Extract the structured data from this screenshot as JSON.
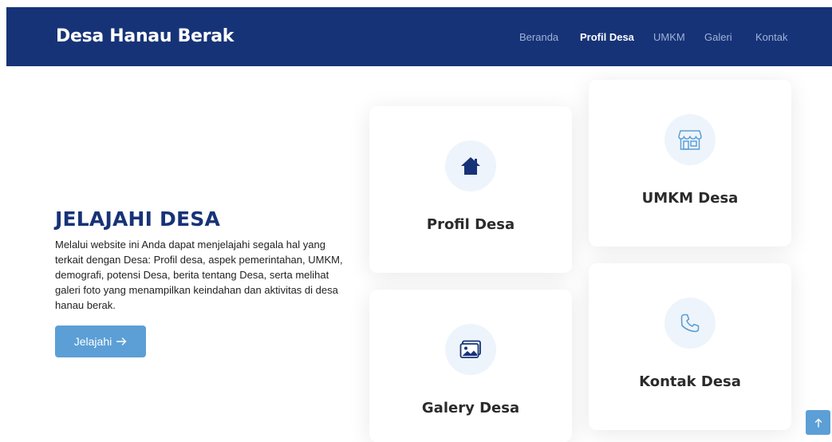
{
  "navbar": {
    "brand": "Desa Hanau Berak",
    "links": [
      {
        "label": "Beranda",
        "active": false
      },
      {
        "label": "Profil Desa",
        "active": true
      },
      {
        "label": "UMKM",
        "active": false
      },
      {
        "label": "Galeri",
        "active": false
      },
      {
        "label": "Kontak",
        "active": false
      }
    ]
  },
  "hero": {
    "title": "JELAJAHI DESA",
    "description": "Melalui website ini Anda dapat menjelajahi segala hal yang terkait dengan Desa: Profil desa, aspek pemerintahan, UMKM, demografi, potensi Desa, berita tentang Desa, serta melihat galeri foto yang menampilkan keindahan dan aktivitas di desa hanau berak.",
    "button_label": "Jelajahi",
    "button_icon": "arrow-right-icon"
  },
  "cards": [
    {
      "title": "Profil Desa",
      "icon": "house-icon"
    },
    {
      "title": "UMKM Desa",
      "icon": "store-icon"
    },
    {
      "title": "Galery Desa",
      "icon": "image-icon"
    },
    {
      "title": "Kontak Desa",
      "icon": "phone-icon"
    }
  ],
  "scroll_top": {
    "icon": "arrow-up-icon"
  },
  "colors": {
    "navbar_bg": "#173378",
    "nav_link": "#9fb2d6",
    "accent": "#5b9fd6",
    "icon_bg": "#eef4fb",
    "title": "#173378"
  }
}
